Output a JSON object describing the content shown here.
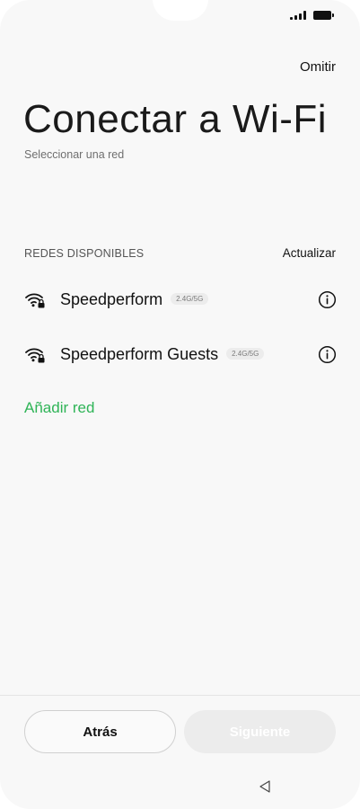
{
  "header": {
    "skip_label": "Omitir",
    "title": "Conectar a Wi-Fi",
    "subtitle": "Seleccionar una red"
  },
  "networks_section": {
    "title": "REDES DISPONIBLES",
    "refresh_label": "Actualizar",
    "networks": [
      {
        "ssid": "Speedperform",
        "band": "2.4G/5G",
        "secured": true
      },
      {
        "ssid": "Speedperform Guests",
        "band": "2.4G/5G",
        "secured": true
      }
    ],
    "add_network_label": "Añadir red"
  },
  "footer": {
    "back_label": "Atrás",
    "next_label": "Siguiente"
  },
  "colors": {
    "accent_green": "#2fb457",
    "disabled_button": "#ececec",
    "background": "#f8f8f8"
  },
  "icons": {
    "status": [
      "signal-icon",
      "battery-icon"
    ],
    "network_item": [
      "wifi-lock-icon",
      "info-icon"
    ],
    "nav": [
      "back-triangle-icon"
    ]
  }
}
